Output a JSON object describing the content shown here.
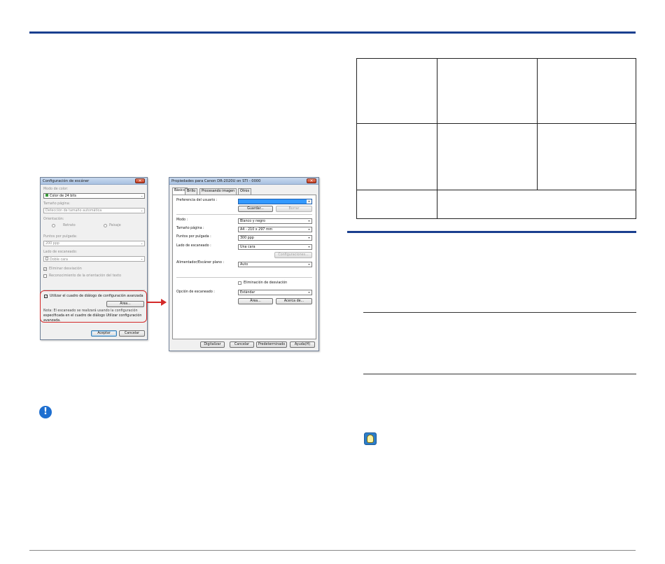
{
  "dialog1": {
    "title": "Configuración de escáner",
    "color_mode_label": "Modo de color:",
    "color_mode_value": "Color de 24 bits",
    "page_size_label": "Tamaño página:",
    "page_size_value": "Detección de tamaño automática",
    "orientation_label": "Orientación:",
    "portrait_label": "Retrato",
    "landscape_label": "Paisaje",
    "dpi_label": "Puntos por pulgada:",
    "dpi_value": "200 ppp",
    "scan_side_label": "Lado de escaneado:",
    "scan_side_value": "Doble cara",
    "deskew_label": "Eliminar desviación",
    "orientation_recog_label": "Reconocimiento de la orientación del texto",
    "advanced_label": "Utilizar el cuadro de diálogo de configuración avanzada",
    "area_button": "Área...",
    "note_line1": "Nota: El escaneado se realizará usando la configuración",
    "note_line2": "especificada en el cuadro de diálogo Utilizar configuración",
    "note_line3": "avanzada.",
    "ok_button": "Aceptar",
    "cancel_button": "Cancelar"
  },
  "dialog2": {
    "title": "Propiedades para Canon DR-2020U on STI - 0000",
    "tabs": [
      "Básico",
      "Brillo",
      "Procesando imagen",
      "Otros"
    ],
    "user_pref_label": "Preferencia del usuario :",
    "save_button": "Guardar...",
    "delete_button": "Borrar",
    "mode_label": "Modo :",
    "mode_value": "Blanco y negro",
    "page_size_label": "Tamaño página :",
    "page_size_value": "A4 - 210 x 297 mm",
    "dpi_label": "Puntos por pulgada :",
    "dpi_value": "300 ppp",
    "scan_side_label": "Lado de escaneado :",
    "scan_side_value": "Una cara",
    "config_button": "Configuraciones...",
    "feeder_label": "Alimentador/Escáner plano :",
    "feeder_value": "Auto",
    "deskew_label": "Eliminación de desviación",
    "scan_option_label": "Opción de escaneado :",
    "scan_option_value": "Estándar",
    "area_button": "Área...",
    "about_button": "Acerca de...",
    "scan_button": "Digitalizar",
    "cancel_button": "Cancelar",
    "default_button": "Predeterminado",
    "help_button": "Ayuda(H)"
  },
  "colors": {
    "accent_rule": "#1a3f8f",
    "highlight": "#d42a2a"
  },
  "icons": {
    "caution": "exclamation-icon",
    "hint": "lightbulb-icon"
  }
}
